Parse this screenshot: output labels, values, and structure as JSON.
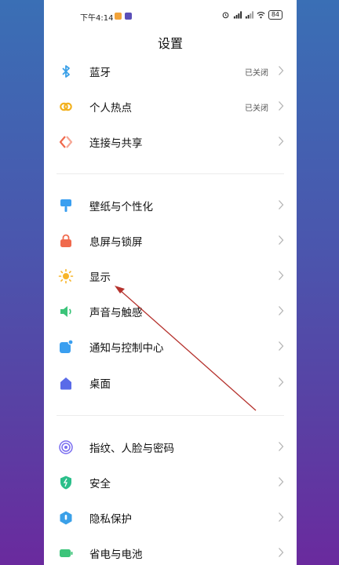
{
  "statusbar": {
    "time": "下午4:14",
    "battery": "84"
  },
  "title": "设置",
  "group1": [
    {
      "label": "蓝牙",
      "value": "已关闭"
    },
    {
      "label": "个人热点",
      "value": "已关闭"
    },
    {
      "label": "连接与共享",
      "value": ""
    }
  ],
  "group2": [
    {
      "label": "壁纸与个性化"
    },
    {
      "label": "息屏与锁屏"
    },
    {
      "label": "显示"
    },
    {
      "label": "声音与触感"
    },
    {
      "label": "通知与控制中心"
    },
    {
      "label": "桌面"
    }
  ],
  "group3": [
    {
      "label": "指纹、人脸与密码"
    },
    {
      "label": "安全"
    },
    {
      "label": "隐私保护"
    },
    {
      "label": "省电与电池"
    }
  ],
  "colors": {
    "bluetooth": "#3aa0e8",
    "hotspot": "#f2b11e",
    "connect": "#f06a4d",
    "wallpaper": "#3a9ff0",
    "lock": "#f06a4d",
    "display": "#f7b52a",
    "sound": "#3cc47a",
    "notify": "#3a9ff0",
    "desktop": "#5a6be8",
    "fingerprint": "#7a6df0",
    "security": "#2bbf8a",
    "privacy": "#3aa0e8",
    "battery": "#3cc47a",
    "annotation": "#b5322d"
  }
}
